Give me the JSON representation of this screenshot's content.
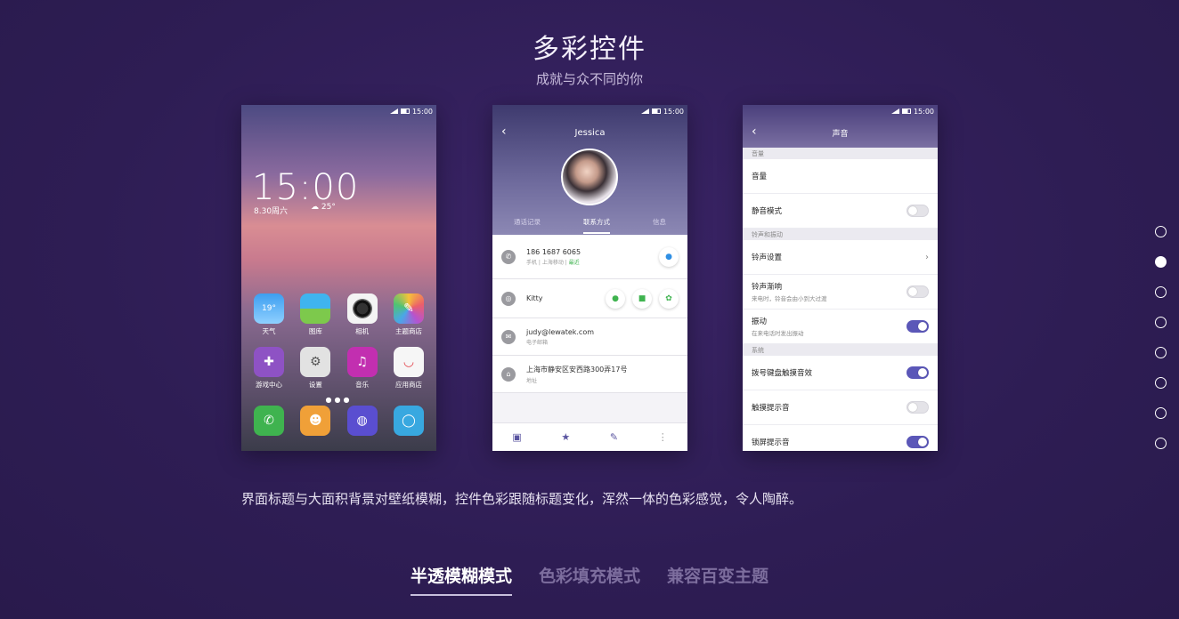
{
  "hero": {
    "title": "多彩控件",
    "subtitle": "成就与众不同的你"
  },
  "home": {
    "status_time": "15:00",
    "clock": "15:00",
    "date": "8.30周六",
    "temp": "25°",
    "row1": [
      {
        "label": "天气",
        "badge": "19°",
        "color": "#2f8fe4"
      },
      {
        "label": "图库",
        "color": "#47b3e0"
      },
      {
        "label": "相机",
        "color": "#ffffff"
      },
      {
        "label": "主题商店",
        "color": "#e25b8f"
      }
    ],
    "row2": [
      {
        "label": "游戏中心",
        "color": "#8e52c4"
      },
      {
        "label": "设置",
        "color": "#dcdcdc"
      },
      {
        "label": "音乐",
        "color": "#c22fb0"
      },
      {
        "label": "应用商店",
        "color": "#f4f4f4"
      }
    ],
    "dock": [
      {
        "name": "phone",
        "color": "#3fb34f"
      },
      {
        "name": "contacts",
        "color": "#f0a038"
      },
      {
        "name": "browser",
        "color": "#5a4ed0"
      },
      {
        "name": "messages",
        "color": "#38a8e0"
      }
    ]
  },
  "contact": {
    "status_time": "15:00",
    "name": "Jessica",
    "tabs": [
      "通话记录",
      "联系方式",
      "信息"
    ],
    "phone": "186 1687 6065",
    "phone_meta": "手机 | 上海移动 | ",
    "phone_recent": "最近",
    "wechat": "Kitty",
    "email": "judy@lewatek.com",
    "email_label": "电子邮箱",
    "address": "上海市静安区安西路300弄17号",
    "address_label": "地址"
  },
  "sound": {
    "status_time": "15:00",
    "title": "声音",
    "sec1": "音量",
    "volume": "音量",
    "silent": "静音模式",
    "sec2": "铃声和振动",
    "ringtone": "铃声设置",
    "fade": "铃声渐响",
    "fade_desc": "来电时，铃音会由小到大过渡",
    "vibrate": "振动",
    "vibrate_desc": "在来电话时发出振动",
    "sec3": "系统",
    "dialpad": "拨号键盘触摸音效",
    "touch": "触摸提示音",
    "lock": "锁屏提示音"
  },
  "description": "界面标题与大面积背景对壁纸模糊，控件色彩跟随标题变化，浑然一体的色彩感觉，令人陶醉。",
  "modes": [
    "半透模糊模式",
    "色彩填充模式",
    "兼容百变主题"
  ]
}
